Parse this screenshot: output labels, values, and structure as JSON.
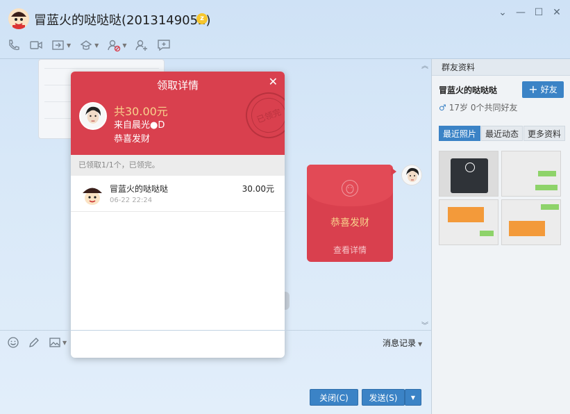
{
  "window": {
    "title": "冒蓝火的哒哒哒(2013149052)",
    "controls": [
      "chevron-down-icon",
      "minimize-icon",
      "maximize-icon",
      "close-icon"
    ]
  },
  "toolbar": {
    "icons": [
      "phone-icon",
      "video-icon",
      "transfer-file-icon",
      "remote-assist-icon",
      "block-user-icon",
      "add-contact-icon",
      "create-group-icon"
    ]
  },
  "popup": {
    "title": "领取详情",
    "amount": "共30.00元",
    "from": "来自晨光●D",
    "wish": "恭喜发财",
    "stamp": "已领完",
    "summary": "已领取1/1个，已领完。",
    "records": [
      {
        "name": "冒蓝火的哒哒哒",
        "time": "06-22 22:24",
        "amount": "30.00元"
      }
    ]
  },
  "envelope": {
    "wish": "恭喜发财",
    "detail": "查看详情",
    "color": "#d9404e"
  },
  "input": {
    "icons": [
      "emoji-icon",
      "pen-icon",
      "image-icon"
    ],
    "message_log": "消息记录"
  },
  "buttons": {
    "close": "关闭(C)",
    "send": "发送(S)"
  },
  "side_panel": {
    "header": "群友资料",
    "name": "冒蓝火的哒哒哒",
    "add_friend": "好友",
    "meta": "17岁  0个共同好友",
    "tabs": [
      "最近照片",
      "最近动态",
      "更多资料"
    ],
    "active_tab": "最近照片"
  },
  "colors": {
    "accent": "#3b83c6",
    "red_packet": "#d9404e",
    "gold": "#f8d28c"
  }
}
